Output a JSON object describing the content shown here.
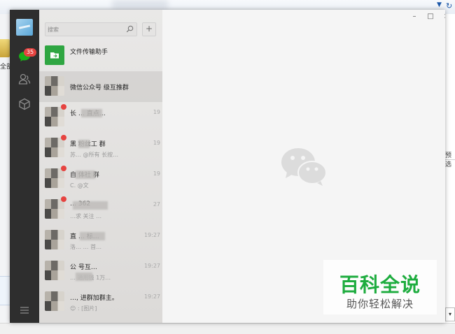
{
  "background": {
    "left_label": "全部",
    "right_label": "预选",
    "top_arrow": "▼",
    "top_refresh": "↻"
  },
  "nav": {
    "chat_badge": "35"
  },
  "search": {
    "placeholder": "搜索",
    "add_label": "+"
  },
  "chats": [
    {
      "name": "文件传输助手",
      "preview": "",
      "time": ""
    },
    {
      "name": "微信公众号 级互推群",
      "preview": "",
      "time": ""
    },
    {
      "name": "长 … 直点…",
      "preview": "",
      "time": "19"
    },
    {
      "name": "黑 粉丝工 群",
      "preview": "苏… @所有 长按…",
      "time": "19"
    },
    {
      "name": "自 体社 群",
      "preview": "C. @文",
      "time": "19"
    },
    {
      "name": "… 362",
      "preview": "…求 关注 …",
      "time": "27"
    },
    {
      "name": "直 … 标…",
      "preview": "洛… … 首…",
      "time": "19:27"
    },
    {
      "name": "公 号互…",
      "preview": "… 通用钱 1万…",
      "time": "19:27"
    },
    {
      "name": "…, 进群加群主。",
      "preview": "😊 : [图片]",
      "time": "19:27"
    }
  ],
  "window_controls": {
    "minimize": "–",
    "maximize": "□",
    "close": "×"
  },
  "watermark": {
    "title": "百科全说",
    "subtitle": "助你轻松解决"
  },
  "colors": {
    "nav_bg": "#2e2e2e",
    "badge": "#e64340",
    "file_helper": "#2fa642",
    "brand_green": "#1dac3e"
  }
}
